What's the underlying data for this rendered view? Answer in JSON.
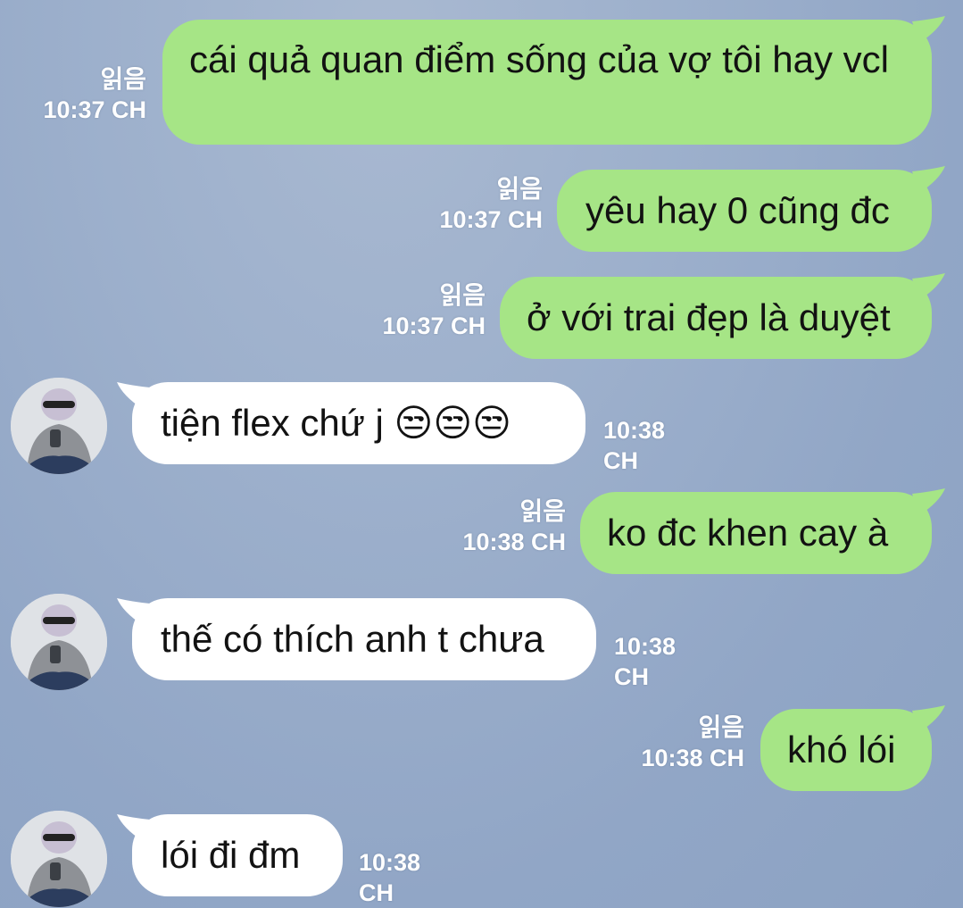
{
  "read_label": "읽음",
  "colors": {
    "outgoing_bubble": "#a6e586",
    "incoming_bubble": "#ffffff",
    "background": "#9db0cc"
  },
  "messages": [
    {
      "direction": "out",
      "text": "cái quả quan điểm sống của vợ tôi hay vcl",
      "time": "10:37 CH",
      "read": "읽음"
    },
    {
      "direction": "out",
      "text": "yêu hay 0 cũng đc",
      "time": "10:37 CH",
      "read": "읽음"
    },
    {
      "direction": "out",
      "text": "ở với trai đẹp là duyệt",
      "time": "10:37 CH",
      "read": "읽음"
    },
    {
      "direction": "in",
      "text": "tiện flex chứ j 😒😒😒",
      "time": "10:38 CH"
    },
    {
      "direction": "out",
      "text": "ko đc khen cay à",
      "time": "10:38 CH",
      "read": "읽음"
    },
    {
      "direction": "in",
      "text": "thế có thích anh t chưa",
      "time": "10:38 CH"
    },
    {
      "direction": "out",
      "text": "khó lói",
      "time": "10:38 CH",
      "read": "읽음"
    },
    {
      "direction": "in",
      "text": "lói đi đm",
      "time": "10:38 CH"
    }
  ]
}
